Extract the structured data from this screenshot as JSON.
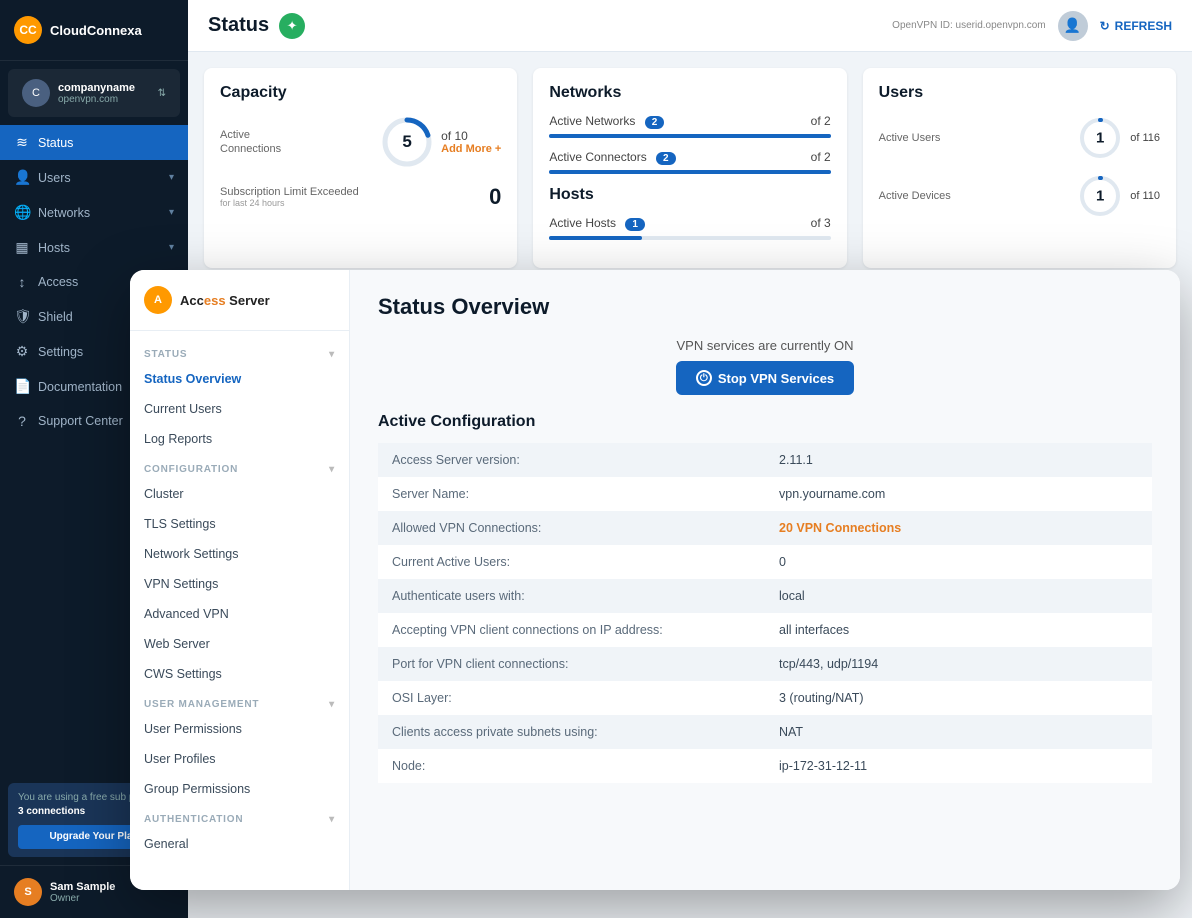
{
  "cloudconnexa": {
    "logo": "CloudConnexa",
    "account": {
      "name": "companyname",
      "sub": "openvpn.com",
      "chevron": "▲▼"
    },
    "nav": [
      {
        "id": "status",
        "icon": "≋",
        "label": "Status",
        "active": true
      },
      {
        "id": "users",
        "icon": "👤",
        "label": "Users",
        "has_chevron": true
      },
      {
        "id": "networks",
        "icon": "🌐",
        "label": "Networks",
        "has_chevron": true
      },
      {
        "id": "hosts",
        "icon": "▦",
        "label": "Hosts",
        "has_chevron": true
      },
      {
        "id": "access",
        "icon": "↕",
        "label": "Access",
        "has_chevron": true
      },
      {
        "id": "shield",
        "icon": "🛡",
        "label": "Shield"
      },
      {
        "id": "settings",
        "icon": "⚙",
        "label": "Settings"
      },
      {
        "id": "documentation",
        "icon": "📄",
        "label": "Documentation"
      },
      {
        "id": "support",
        "icon": "?",
        "label": "Support Center"
      }
    ],
    "free_banner": {
      "text": "You are using a free subscription plan with",
      "highlight": "3 connections",
      "upgrade_label": "Upgrade Your Plan"
    },
    "user": {
      "name": "Sam Sample",
      "role": "Owner"
    },
    "header": {
      "title": "Status",
      "openvpn_id_label": "OpenVPN ID:",
      "openvpn_id_value": "userid.openvpn.com",
      "refresh_label": "REFRESH"
    },
    "capacity": {
      "title": "Capacity",
      "active_connections_label": "Active\nConnections",
      "value": 5,
      "of_value": "of 10",
      "add_label": "Add More +",
      "exceeded_label": "Subscription Limit Exceeded",
      "exceeded_sub": "for last 24 hours",
      "exceeded_value": 0
    },
    "networks": {
      "title": "Networks",
      "rows": [
        {
          "label": "Active Networks",
          "count": 2,
          "of": "of 2",
          "bar_pct": 100
        },
        {
          "label": "Active Connectors",
          "count": 2,
          "of": "of 2",
          "bar_pct": 100
        }
      ]
    },
    "users_card": {
      "title": "Users",
      "rows": [
        {
          "label": "Active Users",
          "value": 1,
          "of": "of 116"
        },
        {
          "label": "Active Devices",
          "value": 1,
          "of": "of 110"
        }
      ]
    },
    "hosts_card": {
      "title": "Hosts",
      "active_label": "Active Hosts",
      "active_value": 1,
      "of": "of 3"
    }
  },
  "access_server": {
    "logo": {
      "text_start": "Acc",
      "text_highlight": "ess",
      "text_end": " Server"
    },
    "sidebar": {
      "sections": [
        {
          "label": "STATUS",
          "items": [
            {
              "id": "status-overview",
              "label": "Status Overview",
              "active": true
            },
            {
              "id": "current-users",
              "label": "Current Users"
            },
            {
              "id": "log-reports",
              "label": "Log Reports"
            }
          ]
        },
        {
          "label": "CONFIGURATION",
          "items": [
            {
              "id": "cluster",
              "label": "Cluster"
            },
            {
              "id": "tls-settings",
              "label": "TLS Settings"
            },
            {
              "id": "network-settings",
              "label": "Network Settings"
            },
            {
              "id": "vpn-settings",
              "label": "VPN Settings"
            },
            {
              "id": "advanced-vpn",
              "label": "Advanced VPN"
            },
            {
              "id": "web-server",
              "label": "Web Server"
            },
            {
              "id": "cws-settings",
              "label": "CWS Settings"
            }
          ]
        },
        {
          "label": "USER MANAGEMENT",
          "items": [
            {
              "id": "user-permissions",
              "label": "User Permissions"
            },
            {
              "id": "user-profiles",
              "label": "User Profiles"
            },
            {
              "id": "group-permissions",
              "label": "Group Permissions"
            }
          ]
        },
        {
          "label": "AUTHENTICATION",
          "items": [
            {
              "id": "general",
              "label": "General"
            }
          ]
        }
      ]
    },
    "main": {
      "title": "Status Overview",
      "vpn_status_text": "VPN services are currently ON",
      "stop_btn_label": "Stop VPN Services",
      "active_config_title": "Active Configuration",
      "config_rows": [
        {
          "label": "Access Server version:",
          "value": "2.11.1",
          "orange": false
        },
        {
          "label": "Server Name:",
          "value": "vpn.yourname.com",
          "orange": false
        },
        {
          "label": "Allowed VPN Connections:",
          "value": "20 VPN Connections",
          "orange": true
        },
        {
          "label": "Current Active Users:",
          "value": "0",
          "orange": false
        },
        {
          "label": "Authenticate users with:",
          "value": "local",
          "orange": false
        },
        {
          "label": "Accepting VPN client connections on IP address:",
          "value": "all interfaces",
          "orange": false
        },
        {
          "label": "Port for VPN client connections:",
          "value": "tcp/443, udp/1194",
          "orange": false
        },
        {
          "label": "OSI Layer:",
          "value": "3 (routing/NAT)",
          "orange": false
        },
        {
          "label": "Clients access private subnets using:",
          "value": "NAT",
          "orange": false
        },
        {
          "label": "Node:",
          "value": "ip-172-31-12-11",
          "orange": false
        }
      ]
    }
  }
}
